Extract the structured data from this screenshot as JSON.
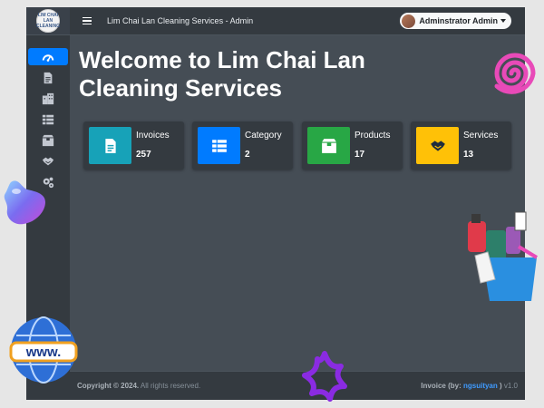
{
  "brand": {
    "logo_text": "LIM CHAI LAN CLEANING"
  },
  "topbar": {
    "title": "Lim Chai Lan Cleaning Services - Admin",
    "user_name": "Adminstrator Admin"
  },
  "sidebar": {
    "items": [
      {
        "icon": "dashboard-icon",
        "active": true
      },
      {
        "icon": "invoice-icon"
      },
      {
        "icon": "building-icon"
      },
      {
        "icon": "list-icon"
      },
      {
        "icon": "box-icon"
      },
      {
        "icon": "handshake-icon"
      },
      {
        "icon": "gears-icon"
      }
    ]
  },
  "main": {
    "welcome": "Welcome to Lim Chai Lan Cleaning Services"
  },
  "cards": [
    {
      "label": "Invoices",
      "count": "257",
      "icon": "document-icon",
      "color": "#17a2b8"
    },
    {
      "label": "Category",
      "count": "2",
      "icon": "list-icon",
      "color": "#007bff"
    },
    {
      "label": "Products",
      "count": "17",
      "icon": "box-icon",
      "color": "#28a745"
    },
    {
      "label": "Services",
      "count": "13",
      "icon": "handshake-icon",
      "color": "#ffc107"
    }
  ],
  "footer": {
    "copyright": "Copyright © 2024.",
    "rights": " All rights reserved.",
    "invoice_prefix": "Invoice (by: ",
    "author": "ngsuityan",
    "suffix": " ) ",
    "version": "v1.0"
  }
}
